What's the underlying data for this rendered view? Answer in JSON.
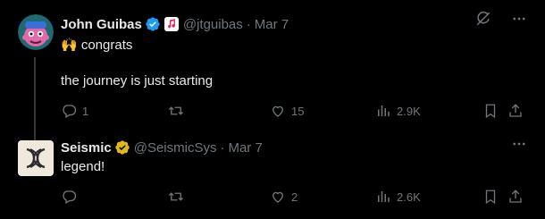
{
  "tweets": [
    {
      "author": {
        "name": "John Guibas",
        "handle": "@jtguibas",
        "date": "Mar 7",
        "verified_color": "#1d9bf0"
      },
      "lines": [
        "🙌 congrats",
        "the journey is just starting"
      ],
      "stats": {
        "replies": "1",
        "retweets": "",
        "likes": "15",
        "views": "2.9K"
      }
    },
    {
      "author": {
        "name": "Seismic",
        "handle": "@SeismicSys",
        "date": "Mar 7",
        "verified_color": "#e2b719"
      },
      "lines": [
        "legend!"
      ],
      "stats": {
        "replies": "",
        "retweets": "",
        "likes": "2",
        "views": "2.6K"
      }
    }
  ],
  "separator": "·",
  "icons": [
    "reply-icon",
    "retweet-icon",
    "like-icon",
    "views-icon",
    "bookmark-icon",
    "share-icon",
    "more-icon",
    "grok-icon",
    "verified-icon"
  ]
}
